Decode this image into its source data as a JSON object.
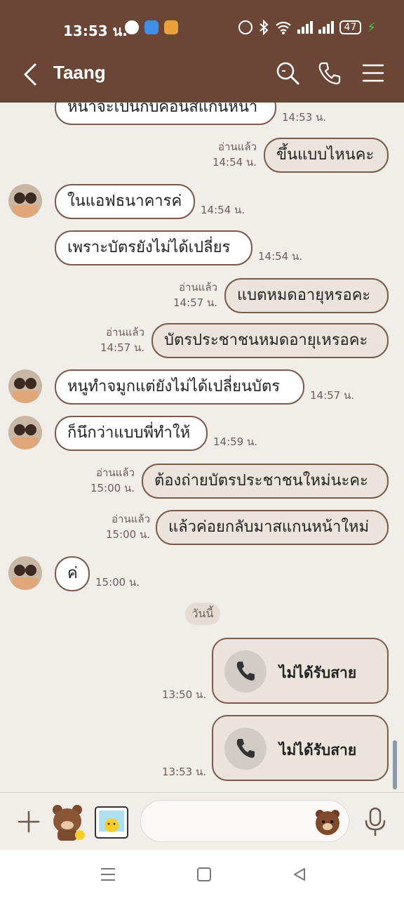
{
  "status_bar": {
    "time": "13:53 น.",
    "battery": "47"
  },
  "header": {
    "title": "Taang"
  },
  "messages": [
    {
      "text": "หน้าจะเป็นกับคอนสแกนหน้า",
      "time": "14:53 น."
    },
    {
      "text": "ขึ้นแบบไหนคะ",
      "read": "อ่านแล้ว",
      "time": "14:54 น."
    },
    {
      "text": "ในแอฟธนาคารค่",
      "time": "14:54 น."
    },
    {
      "text": "เพราะบัตรยังไม่ได้เปลี่ยร",
      "time": "14:54 น."
    },
    {
      "text": "แบตหมดอายุหรอคะ",
      "read": "อ่านแล้ว",
      "time": "14:57 น."
    },
    {
      "text": "บัตรประชาชนหมดอายุเหรอคะ",
      "read": "อ่านแล้ว",
      "time": "14:57 น."
    },
    {
      "text": "หนูทำจมูกแต่ยังไม่ได้เปลี่ยนบัตร",
      "time": "14:57 น."
    },
    {
      "text": "ก็นึกว่าแบบพี่ทำให้",
      "time": "14:59 น."
    },
    {
      "text": "ต้องถ่ายบัตรประชาชนใหม่นะคะ",
      "read": "อ่านแล้ว",
      "time": "15:00 น."
    },
    {
      "text": "แล้วค่อยกลับมาสแกนหน้าใหม่",
      "read": "อ่านแล้ว",
      "time": "15:00 น."
    },
    {
      "text": "ค่",
      "time": "15:00 น."
    }
  ],
  "day_separator": "วันนี้",
  "calls": [
    {
      "label": "ไม่ได้รับสาย",
      "time": "13:50 น."
    },
    {
      "label": "ไม่ได้รับสาย",
      "time": "13:53 น."
    }
  ],
  "colors": {
    "brand": "#6b4636",
    "bubble_border": "#7a5a4c",
    "background": "#f1ede8"
  },
  "icons": {
    "back": "chevron-left-icon",
    "search": "search-icon",
    "call": "phone-icon",
    "menu": "hamburger-menu-icon",
    "plus": "plus-icon",
    "sticker": "bear-sticker-icon",
    "photo": "photo-sticker-icon",
    "emoji": "bear-emoji-icon",
    "mic": "microphone-icon"
  }
}
